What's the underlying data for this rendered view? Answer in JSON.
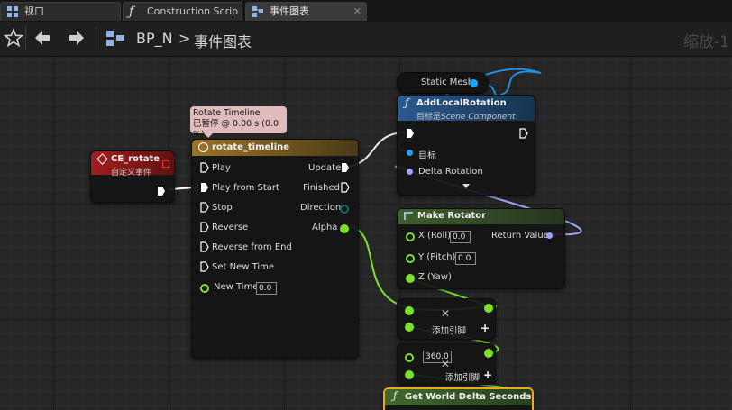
{
  "tabs": [
    {
      "label": "视口",
      "icon": "viewport-icon",
      "active": false
    },
    {
      "label": "Construction Scrip",
      "icon": "function-icon",
      "active": false
    },
    {
      "label": "事件图表",
      "icon": "event-graph-icon",
      "active": true
    }
  ],
  "toolbar": {
    "breadcrumb_root": "BP_N",
    "breadcrumb_separator": ">",
    "breadcrumb_graph": "事件图表",
    "zoom": "缩放-1"
  },
  "nodes": {
    "timeline_comment": {
      "line1": "Rotate Timeline",
      "line2": "已暂停 @ 0.00 s (0.0 %)"
    },
    "ce_rotate": {
      "title": "CE_rotate",
      "subtitle": "自定义事件"
    },
    "timeline": {
      "title": "rotate_timeline",
      "inputs": [
        "Play",
        "Play from Start",
        "Stop",
        "Reverse",
        "Reverse from End",
        "Set New Time"
      ],
      "new_time_label": "New Time",
      "new_time_value": "0.0",
      "outputs": [
        "Update",
        "Finished",
        "Direction",
        "Alpha"
      ]
    },
    "static_mesh": {
      "label": "Static Mesh"
    },
    "add_local_rotation": {
      "title": "AddLocalRotation",
      "subtitle_prefix": "目标是",
      "subtitle_class": "Scene Component",
      "target_label": "目标",
      "delta_label": "Delta Rotation"
    },
    "make_rotator": {
      "title": "Make Rotator",
      "x_label": "X (Roll)",
      "x_value": "0.0",
      "y_label": "Y (Pitch)",
      "y_value": "0.0",
      "z_label": "Z (Yaw)",
      "return_label": "Return Value"
    },
    "multiply": {
      "add_pin_label": "添加引脚"
    },
    "multiply2": {
      "value": "360.0",
      "add_pin_label": "添加引脚"
    },
    "world_delta": {
      "title": "Get World Delta Seconds"
    }
  },
  "colors": {
    "background": "#262626",
    "exec_pin": "#ffffff",
    "float_pin": "#7ce12d",
    "struct_pin": "#9aa4ff",
    "object_pin": "#1ea0ff",
    "event_header": "#8c1b1b",
    "function_header": "#1d3c63",
    "timeline_header": "#7a6024",
    "pure_header": "#4b6a2d"
  }
}
